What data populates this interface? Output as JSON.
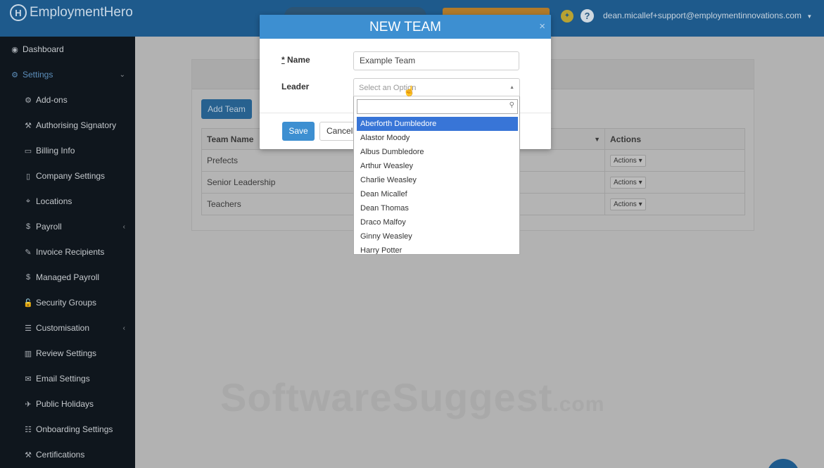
{
  "topbar": {
    "brand": "EmploymentHero",
    "brand_mark": "H",
    "user_email": "dean.micallef+support@employmentinnovations.com",
    "help_icon": "?",
    "coin_icon": "coin-icon"
  },
  "sidebar": {
    "items": [
      {
        "label": "Dashboard",
        "icon": "dashboard-icon",
        "glyph": "◉",
        "level": "top"
      },
      {
        "label": "Settings",
        "icon": "gears-icon",
        "glyph": "⚙",
        "level": "top",
        "active": true,
        "chev": "⌄"
      },
      {
        "label": "Add-ons",
        "icon": "gears-icon",
        "glyph": "⚙",
        "level": "sub"
      },
      {
        "label": "Authorising Signatory",
        "icon": "hammer-icon",
        "glyph": "⚒",
        "level": "sub"
      },
      {
        "label": "Billing Info",
        "icon": "credit-card-icon",
        "glyph": "▭",
        "level": "sub"
      },
      {
        "label": "Company Settings",
        "icon": "building-icon",
        "glyph": "▯",
        "level": "sub"
      },
      {
        "label": "Locations",
        "icon": "map-marker-icon",
        "glyph": "⌖",
        "level": "sub"
      },
      {
        "label": "Payroll",
        "icon": "dollar-icon",
        "glyph": "$",
        "level": "sub",
        "chev": "‹"
      },
      {
        "label": "Invoice Recipients",
        "icon": "edit-icon",
        "glyph": "✎",
        "level": "sub"
      },
      {
        "label": "Managed Payroll",
        "icon": "dollar-icon",
        "glyph": "$",
        "level": "sub"
      },
      {
        "label": "Security Groups",
        "icon": "unlock-icon",
        "glyph": "🔓",
        "level": "sub"
      },
      {
        "label": "Customisation",
        "icon": "list-icon",
        "glyph": "☰",
        "level": "sub",
        "chev": "‹"
      },
      {
        "label": "Review Settings",
        "icon": "bar-chart-icon",
        "glyph": "▥",
        "level": "sub"
      },
      {
        "label": "Email Settings",
        "icon": "inbox-icon",
        "glyph": "✉",
        "level": "sub"
      },
      {
        "label": "Public Holidays",
        "icon": "plane-icon",
        "glyph": "✈",
        "level": "sub"
      },
      {
        "label": "Onboarding Settings",
        "icon": "list-alt-icon",
        "glyph": "☷",
        "level": "sub"
      },
      {
        "label": "Certifications",
        "icon": "gavel-icon",
        "glyph": "⚒",
        "level": "sub"
      }
    ]
  },
  "main": {
    "add_team_label": "Add Team",
    "table": {
      "headers": [
        "Team Name",
        "",
        "Actions"
      ],
      "rows": [
        {
          "name": "Prefects",
          "action": "Actions ▾"
        },
        {
          "name": "Senior Leadership",
          "action": "Actions ▾"
        },
        {
          "name": "Teachers",
          "action": "Actions ▾"
        }
      ]
    },
    "watermark": "SoftwareSuggest",
    "watermark_suffix": ".com"
  },
  "modal": {
    "title": "NEW TEAM",
    "close_icon": "×",
    "name_label": "Name",
    "required_mark": "*",
    "name_value": "Example Team",
    "leader_label": "Leader",
    "leader_placeholder": "Select an Option",
    "save_label": "Save",
    "cancel_label": "Cancel",
    "options": [
      "Aberforth Dumbledore",
      "Alastor Moody",
      "Albus Dumbledore",
      "Arthur Weasley",
      "Charlie Weasley",
      "Dean Micallef",
      "Dean Thomas",
      "Draco Malfoy",
      "Ginny Weasley",
      "Harry Potter"
    ],
    "selected_option": "Aberforth Dumbledore"
  }
}
